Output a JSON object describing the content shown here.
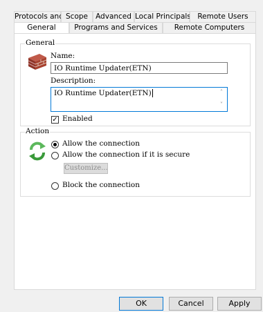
{
  "tabs": {
    "top": [
      "Protocols and Ports",
      "Scope",
      "Advanced",
      "Local Principals",
      "Remote Users"
    ],
    "bottom": [
      "General",
      "Programs and Services",
      "Remote Computers"
    ],
    "selected": "General"
  },
  "general": {
    "title": "General",
    "name_label": "Name:",
    "name_value": "IO Runtime Updater(ETN)",
    "description_label": "Description:",
    "description_value": "IO Runtime Updater(ETN)",
    "enabled_label": "Enabled",
    "enabled_checked": true,
    "icon": "firewall-brick-icon"
  },
  "action": {
    "title": "Action",
    "icon": "refresh-arrows-icon",
    "options": [
      "Allow the connection",
      "Allow the connection if it is secure",
      "Block the connection"
    ],
    "selected_option": "Allow the connection",
    "customize_label": "Customize..."
  },
  "buttons": {
    "ok": "OK",
    "cancel": "Cancel",
    "apply": "Apply"
  }
}
